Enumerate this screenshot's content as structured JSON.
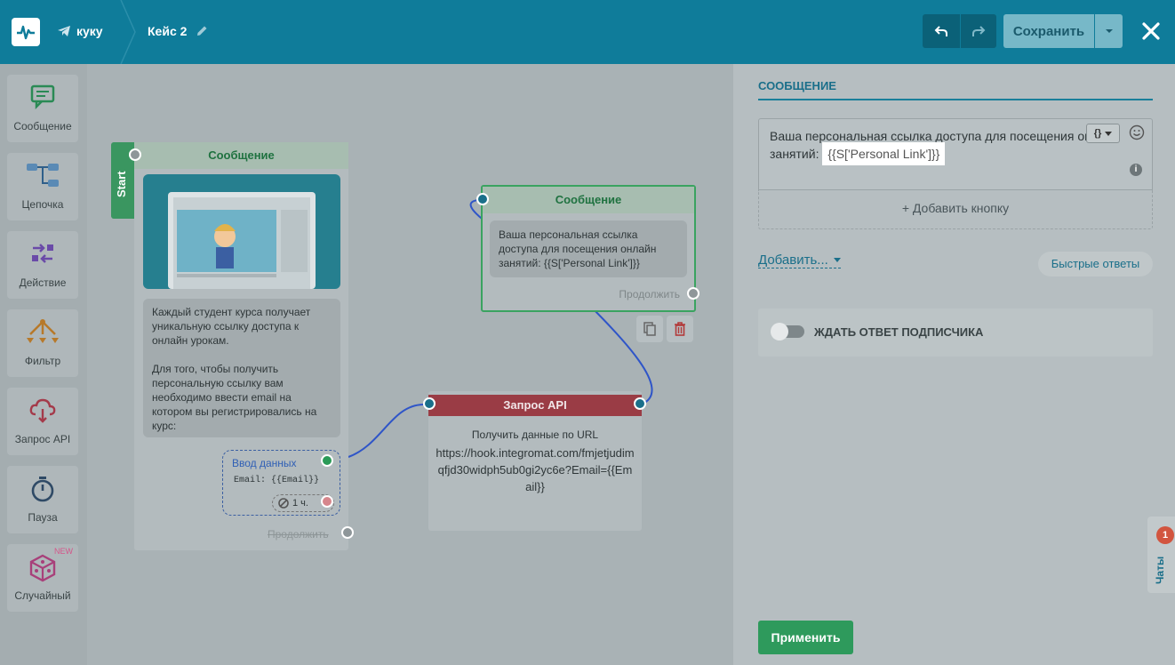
{
  "header": {
    "bot_name": "куку",
    "case_name": "Кейс 2",
    "save_label": "Сохранить"
  },
  "palette": [
    {
      "label": "Сообщение",
      "icon": "message-icon"
    },
    {
      "label": "Цепочка",
      "icon": "chain-icon"
    },
    {
      "label": "Действие",
      "icon": "action-icon"
    },
    {
      "label": "Фильтр",
      "icon": "filter-icon"
    },
    {
      "label": "Запрос API",
      "icon": "api-request-icon"
    },
    {
      "label": "Пауза",
      "icon": "timer-icon"
    },
    {
      "label": "Случайный",
      "icon": "dice-icon",
      "tag": "NEW"
    }
  ],
  "canvas": {
    "start_label": "Start",
    "node1": {
      "title": "Сообщение",
      "text1": "Каждый студент курса получает уникальную ссылку доступа к онлайн урокам.",
      "text2": "Для того, чтобы получить персональную ссылку вам необходимо ввести email на котором вы регистрировались на курс:",
      "input_label": "Ввод данных",
      "input_value": "Email: {{Email}}",
      "timeout": "1 ч.",
      "continue": "Продолжить"
    },
    "node2": {
      "title": "Сообщение",
      "text": "Ваша персональная ссылка доступа для посещения онлайн занятий: {{S['Personal Link']}}",
      "continue": "Продолжить"
    },
    "node3": {
      "title": "Запрос API",
      "subtitle": "Получить данные по URL",
      "url": "https://hook.integromat.com/fmjetjudimqfjd30widph5ub0gi2yc6e?Email={{Email}}"
    }
  },
  "panel": {
    "title": "СООБЩЕНИЕ",
    "message_text": "Ваша персональная ссылка доступа для посещения онлайн занятий: ",
    "message_highlight": "{{S['Personal Link']}}",
    "add_button": "+ Добавить кнопку",
    "add_menu": "Добавить...",
    "quick_replies": "Быстрые ответы",
    "wait_reply": "ЖДАТЬ ОТВЕТ ПОДПИСЧИКА",
    "apply": "Применить"
  },
  "chats": {
    "label": "Чаты",
    "count": "1"
  },
  "colors": {
    "header": "#0f7c9a",
    "green": "#2e9a5c",
    "api_red": "#9a3c45",
    "accent": "#1a6f8a"
  }
}
